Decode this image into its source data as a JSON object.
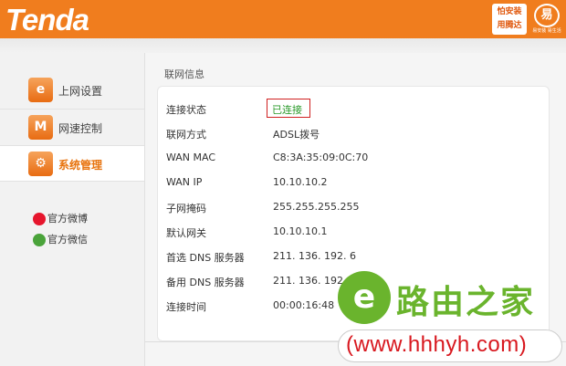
{
  "header": {
    "logo": "Tenda",
    "badge_line1": "怕安装",
    "badge_line2": "用腾达",
    "badge2_char": "易",
    "badge2_sub": "易安装 易生活"
  },
  "sidebar": {
    "items": [
      {
        "label": "上网设置",
        "icon": "globe-e-icon",
        "glyph": "e"
      },
      {
        "label": "网速控制",
        "icon": "speed-wave-icon",
        "glyph": "M"
      },
      {
        "label": "系统管理",
        "icon": "gear-icon",
        "glyph": "⚙"
      }
    ],
    "social": [
      {
        "label": "官方微博",
        "icon": "weibo-icon"
      },
      {
        "label": "官方微信",
        "icon": "wechat-icon"
      }
    ]
  },
  "panel": {
    "title": "联网信息",
    "rows": [
      {
        "key": "连接状态",
        "value": "已连接"
      },
      {
        "key": "联网方式",
        "value": "ADSL拨号"
      },
      {
        "key": "WAN MAC",
        "value": "C8:3A:35:09:0C:70"
      },
      {
        "key": "WAN IP",
        "value": "10.10.10.2"
      },
      {
        "key": "子网掩码",
        "value": "255.255.255.255"
      },
      {
        "key": "默认网关",
        "value": "10.10.10.1"
      },
      {
        "key": "首选 DNS 服务器",
        "value": "211. 136. 192. 6"
      },
      {
        "key": "备用 DNS 服务器",
        "value": "211. 136. 192. 56"
      },
      {
        "key": "连接时间",
        "value": "00:00:16:48"
      }
    ]
  },
  "watermark": {
    "text": "路由之家",
    "url": "(www.hhhyh.com)"
  },
  "colors": {
    "brand": "#f07d1e",
    "status_ok": "#2a9a2a",
    "highlight_border": "#d02020",
    "watermark_green": "#6ab42d",
    "watermark_red": "#d8181f"
  }
}
